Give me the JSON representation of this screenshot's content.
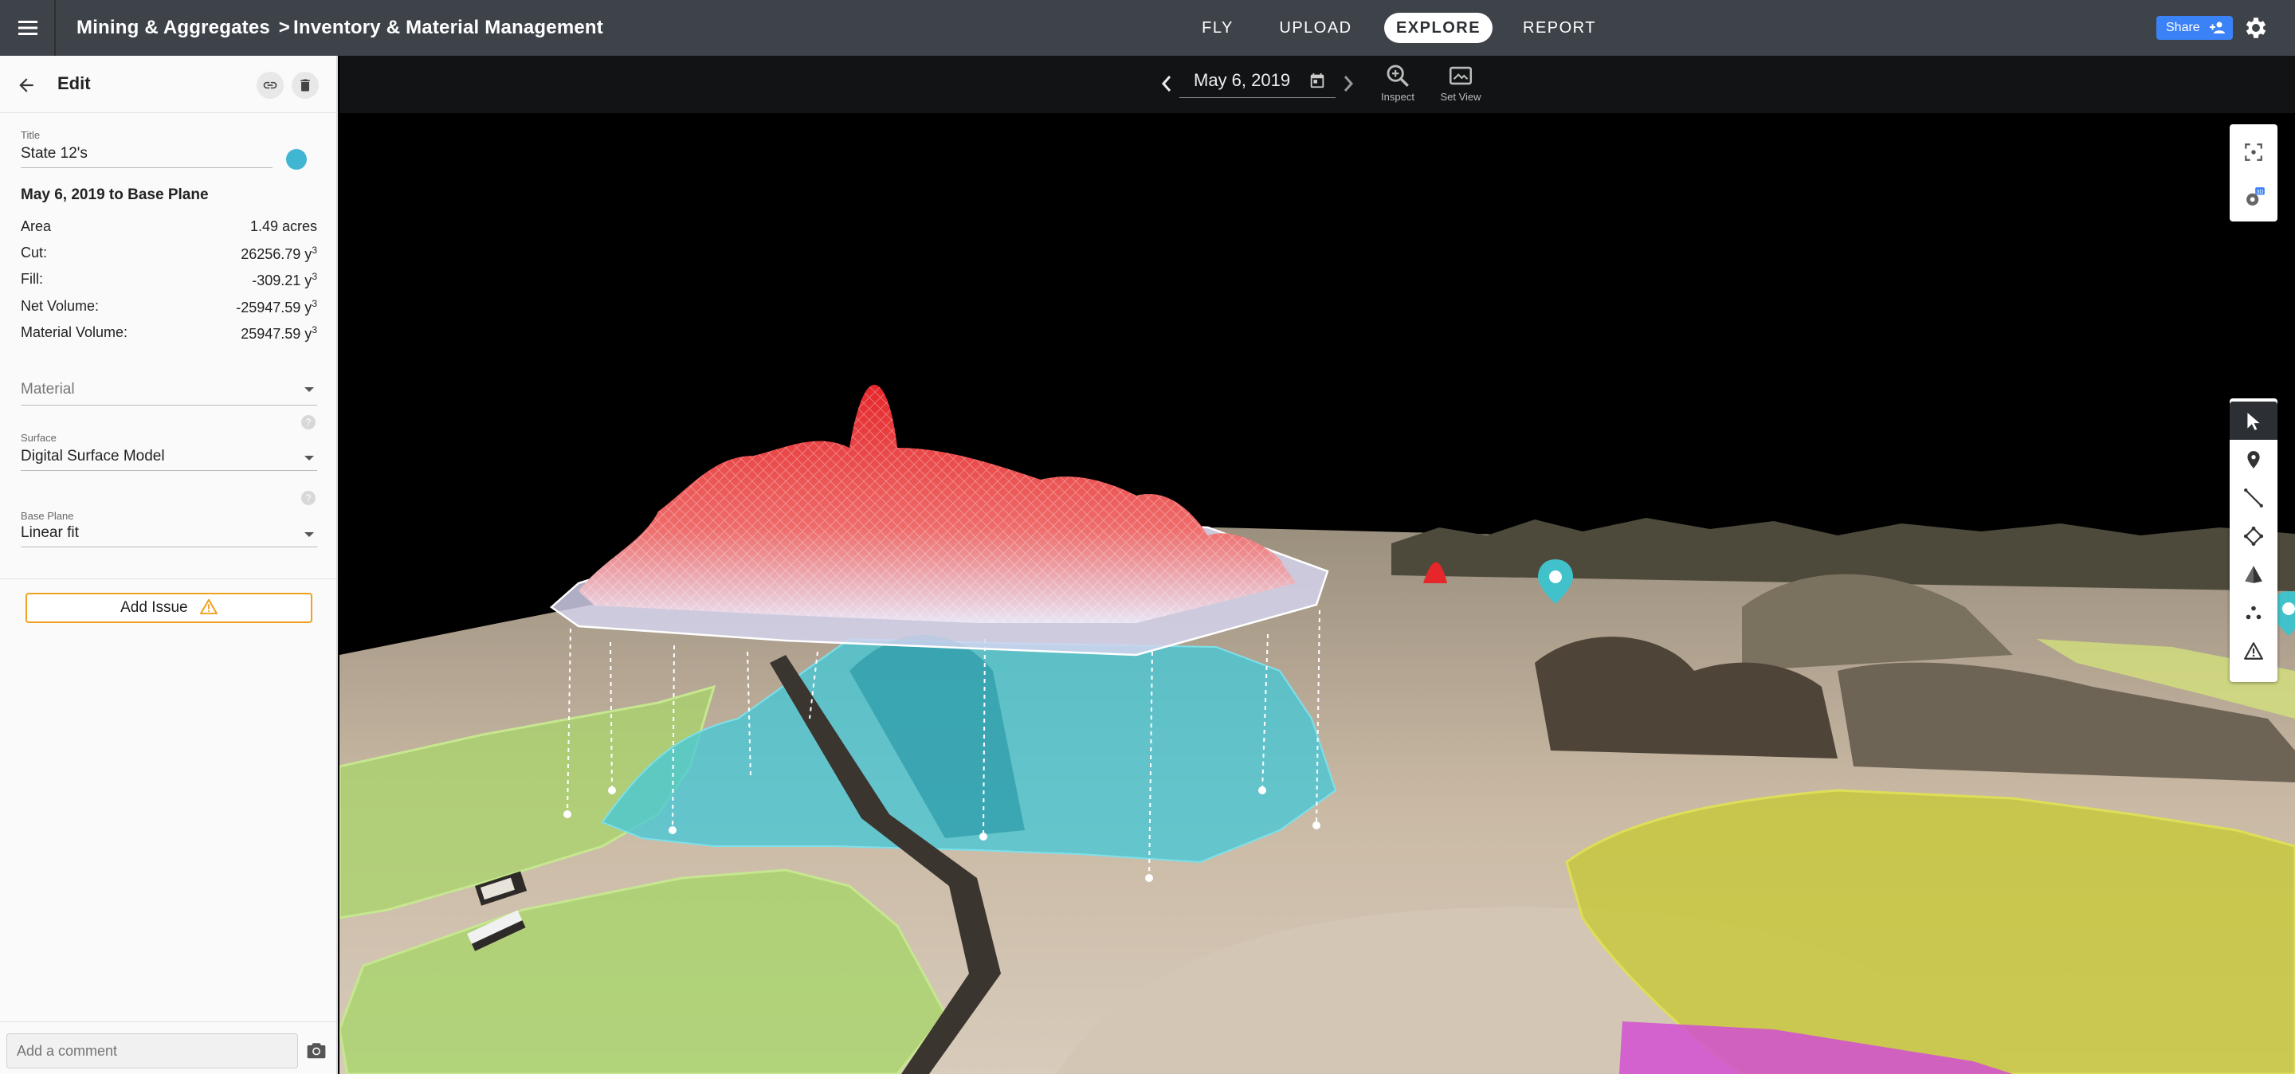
{
  "header": {
    "breadcrumb_parent": "Mining & Aggregates",
    "breadcrumb_sep": ">",
    "breadcrumb_current": "Inventory & Material Management",
    "nav": {
      "fly": "FLY",
      "upload": "UPLOAD",
      "explore": "EXPLORE",
      "report": "REPORT"
    },
    "share_label": "Share"
  },
  "panel": {
    "edit_label": "Edit",
    "title_label": "Title",
    "title_value": "State 12's",
    "marker_color": "#41b6d2",
    "comparison_title": "May 6, 2019 to Base Plane",
    "metrics": [
      {
        "label": "Area",
        "value": "1.49 acres",
        "unit_sup": ""
      },
      {
        "label": "Cut:",
        "value": "26256.79 y",
        "unit_sup": "3"
      },
      {
        "label": "Fill:",
        "value": "-309.21 y",
        "unit_sup": "3"
      },
      {
        "label": "Net Volume:",
        "value": "-25947.59 y",
        "unit_sup": "3"
      },
      {
        "label": "Material Volume:",
        "value": "25947.59 y",
        "unit_sup": "3"
      }
    ],
    "material_placeholder": "Material",
    "surface_label": "Surface",
    "surface_value": "Digital Surface Model",
    "base_plane_label": "Base Plane",
    "base_plane_value": "Linear fit",
    "add_issue_label": "Add Issue",
    "comment_placeholder": "Add a comment"
  },
  "viewer": {
    "date": "May 6, 2019",
    "inspect_label": "Inspect",
    "setview_label": "Set View",
    "badge_3d": "3D"
  },
  "colors": {
    "topbar": "#3e434a",
    "accent_blue": "#3b82f6",
    "issue_orange": "#f0a020",
    "cut_red": "#e8342c",
    "fill_cyan": "#46c8d6",
    "zone_green": "#a8d46a",
    "zone_yellow": "#c8c83a",
    "zone_magenta": "#d24fd2"
  }
}
